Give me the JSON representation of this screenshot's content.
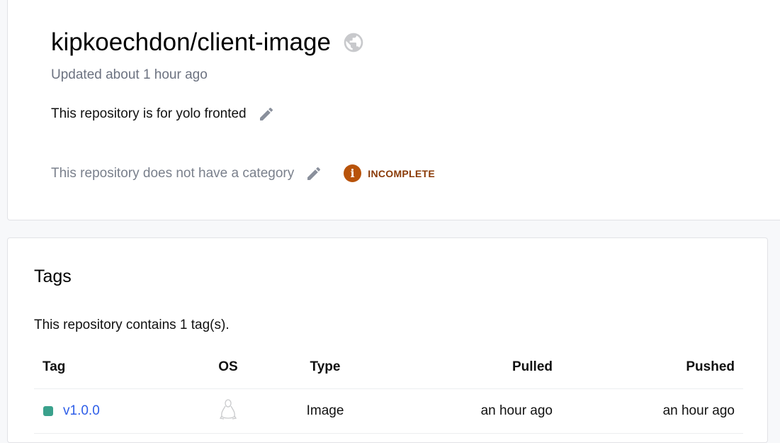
{
  "repo": {
    "name": "kipkoechdon/client-image",
    "updated": "Updated about 1 hour ago",
    "description": "This repository is for yolo fronted",
    "category": "This repository does not have a category",
    "status_badge": "INCOMPLETE",
    "colors": {
      "badge": "#b8530a",
      "tag_dot": "#3aa18c",
      "link": "#2e5ee8"
    }
  },
  "tags": {
    "heading": "Tags",
    "count_text": "This repository contains 1 tag(s).",
    "columns": [
      "Tag",
      "OS",
      "Type",
      "Pulled",
      "Pushed"
    ],
    "rows": [
      {
        "tag": "v1.0.0",
        "os": "linux-icon",
        "type": "Image",
        "pulled": "an hour ago",
        "pushed": "an hour ago"
      }
    ]
  }
}
